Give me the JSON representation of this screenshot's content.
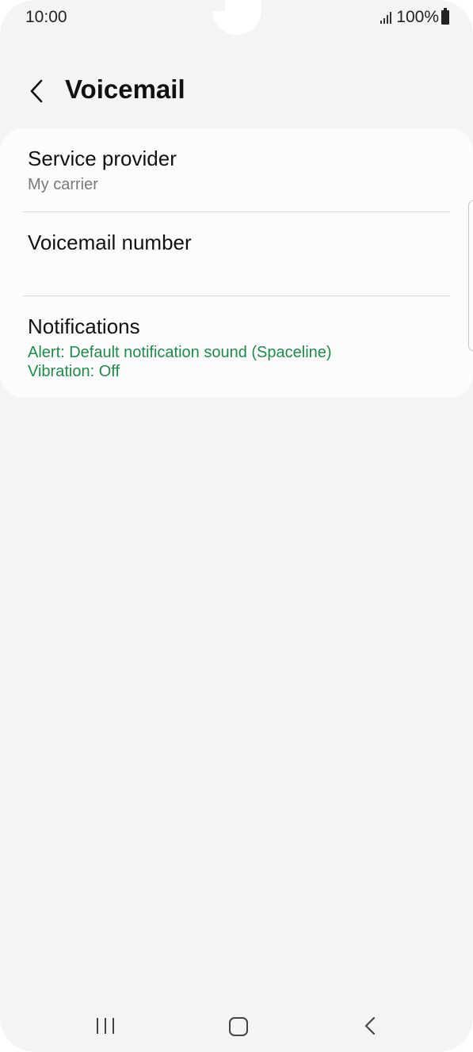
{
  "status_bar": {
    "time": "10:00",
    "battery": "100%"
  },
  "header": {
    "title": "Voicemail"
  },
  "settings": [
    {
      "title": "Service provider",
      "subtitle_lines": [
        "My carrier"
      ]
    },
    {
      "title": "Voicemail number",
      "subtitle_lines": []
    },
    {
      "title": "Notifications",
      "subtitle_lines": [
        "Alert: Default notification sound (Spaceline)",
        "Vibration: Off"
      ]
    }
  ],
  "colors": {
    "background": "#f4f4f4",
    "card": "#fcfcfc",
    "accent_green": "#1f8a4a",
    "subtitle_gray": "#7a7a7a"
  },
  "icons": {
    "back": "back-arrow-icon",
    "signal": "signal-icon",
    "battery": "battery-icon",
    "nav_recents": "recents-icon",
    "nav_home": "home-icon",
    "nav_back": "nav-back-icon"
  }
}
